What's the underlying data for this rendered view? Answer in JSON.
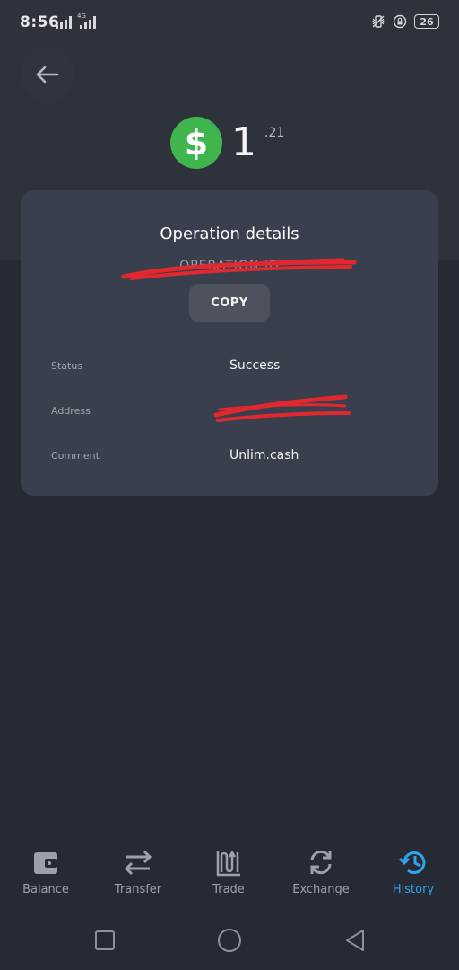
{
  "status_bar": {
    "time": "8:56",
    "network": "4G",
    "battery": "26"
  },
  "amount": {
    "currency_symbol": "$",
    "integer": "1",
    "decimal": ".21"
  },
  "card": {
    "title": "Operation details",
    "operation_id": "OPERATION ID",
    "copy_label": "COPY",
    "rows": [
      {
        "label": "Status",
        "value": "Success"
      },
      {
        "label": "Address",
        "value": ""
      },
      {
        "label": "Comment",
        "value": "Unlim.cash"
      }
    ]
  },
  "nav": {
    "items": [
      {
        "label": "Balance",
        "icon": "wallet-icon"
      },
      {
        "label": "Transfer",
        "icon": "transfer-arrows-icon"
      },
      {
        "label": "Trade",
        "icon": "trade-chart-icon"
      },
      {
        "label": "Exchange",
        "icon": "exchange-cycle-icon"
      },
      {
        "label": "History",
        "icon": "history-clock-icon"
      }
    ],
    "active": "History"
  },
  "colors": {
    "background": "#262a34",
    "card": "#393f4c",
    "accent": "#2fa4e7",
    "coin": "#3fb54d",
    "redaction": "#e0282e"
  }
}
